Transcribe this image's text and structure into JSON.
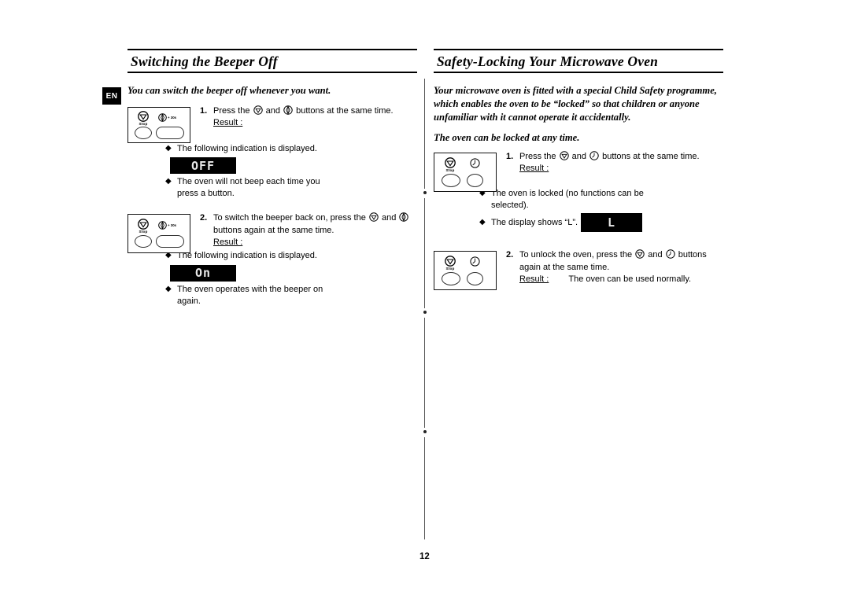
{
  "document": {
    "language_badge": "EN",
    "page_number": "12"
  },
  "left_column": {
    "heading": "Switching the Beeper Off",
    "intro": "You can switch the beeper off whenever you want.",
    "panel_icons": {
      "stop_label": "Stop",
      "plus30_label": "+ 30s"
    },
    "steps": [
      {
        "number": "1.",
        "text_before_icon1": "Press the",
        "icon1": "stop-icon",
        "text_between": "and",
        "icon2": "power-level-icon",
        "text_after": "buttons at the same time.",
        "result_label": "Result :",
        "bullets": [
          {
            "diamond": "◆",
            "text": "The following indication is displayed."
          },
          {
            "diamond": "◆",
            "text": "The oven will not beep each time you press a button."
          }
        ],
        "lcd": "OFF"
      },
      {
        "number": "2.",
        "text_before_icon1": "To switch the beeper back on, press the",
        "icon1": "stop-icon",
        "text_between": "and",
        "icon2": "power-level-icon",
        "text_after": "buttons again at the same time.",
        "result_label": "Result :",
        "bullets": [
          {
            "diamond": "◆",
            "text": "The following indication is displayed."
          },
          {
            "diamond": "◆",
            "text": "The oven operates with the beeper on again."
          }
        ],
        "lcd": "On"
      }
    ]
  },
  "right_column": {
    "heading": "Safety-Locking Your Microwave Oven",
    "intro_1": "Your microwave oven is fitted with a special Child Safety programme, which enables the oven to be “locked” so that children or anyone unfamiliar with it cannot operate it accidentally.",
    "intro_2": "The oven can be locked at any time.",
    "panel_icons": {
      "stop_label": "Stop",
      "clock_label": "clock-icon"
    },
    "steps": [
      {
        "number": "1.",
        "text_before_icon1": "Press the",
        "icon1": "stop-icon",
        "text_between": "and",
        "icon2": "clock-icon",
        "text_after": "buttons at the same time.",
        "result_label": "Result :",
        "bullets": [
          {
            "diamond": "◆",
            "text": "The oven is locked (no functions can be selected)."
          },
          {
            "diamond": "◆",
            "text": "The display shows “L”."
          }
        ],
        "lcd": "L"
      },
      {
        "number": "2.",
        "text_before_icon1": "To unlock the oven, press the",
        "icon1": "stop-icon",
        "text_between": "and",
        "icon2": "clock-icon",
        "text_after": "buttons again at the same time.",
        "result_label": "Result :",
        "result_inline": "The oven can be used normally.",
        "bullets": [],
        "lcd": ""
      }
    ]
  }
}
